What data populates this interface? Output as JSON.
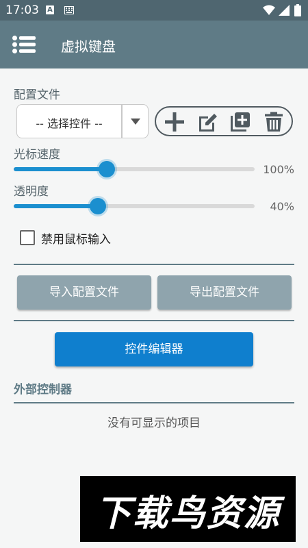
{
  "status_bar": {
    "time": "17:03",
    "notification_letter": "A"
  },
  "app_bar": {
    "title": "虚拟键盘"
  },
  "config": {
    "label": "配置文件",
    "spinner_value": "-- 选择控件 --"
  },
  "cursor_speed": {
    "label": "光标速度",
    "value_text": "100%",
    "level": 0.385
  },
  "opacity": {
    "label": "透明度",
    "value_text": "40%",
    "level": 0.35
  },
  "disable_mouse": {
    "label": "禁用鼠标输入",
    "checked": false
  },
  "buttons": {
    "import": "导入配置文件",
    "export": "导出配置文件",
    "editor": "控件编辑器"
  },
  "external": {
    "header": "外部控制器",
    "empty_text": "没有可显示的项目"
  },
  "watermark": {
    "text": "下载鸟资源"
  },
  "colors": {
    "app_bar": "#5f7b86",
    "status_bar": "#4f6670",
    "accent": "#1b8fcf",
    "primary_button": "#0f7fce",
    "secondary_button": "#8fa4ad"
  }
}
